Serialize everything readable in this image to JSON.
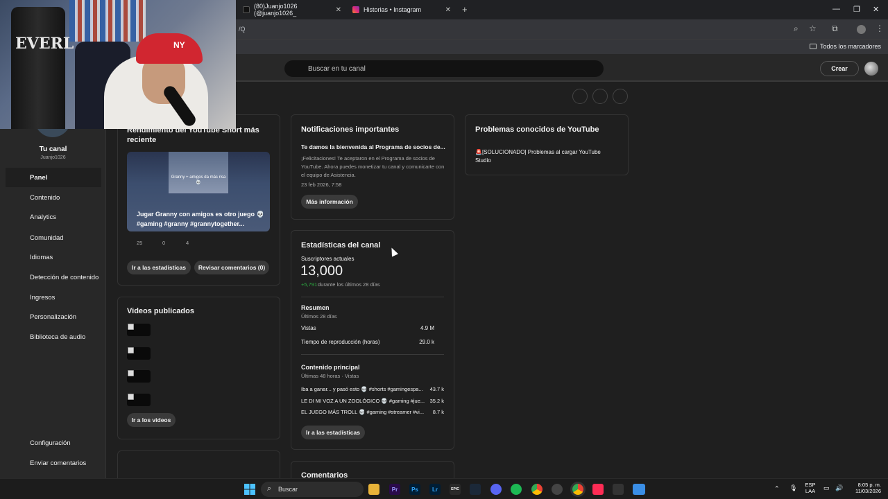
{
  "browser": {
    "tabs": [
      {
        "label": "(80)Juanjo1026 (@juanjo1026_"
      },
      {
        "label": "Historias • Instagram"
      }
    ],
    "address_fragment": "/Q",
    "bookmarks_label": "Todos los marcadores"
  },
  "header": {
    "search_placeholder": "Buscar en tu canal",
    "create_label": "Crear"
  },
  "sidebar": {
    "channel_name": "Tu canal",
    "channel_handle": "Juanjo1026",
    "items": [
      {
        "label": "Panel"
      },
      {
        "label": "Contenido"
      },
      {
        "label": "Analytics"
      },
      {
        "label": "Comunidad"
      },
      {
        "label": "Idiomas"
      },
      {
        "label": "Detección de contenido"
      },
      {
        "label": "Ingresos"
      },
      {
        "label": "Personalización"
      },
      {
        "label": "Biblioteca de audio"
      }
    ],
    "footer": [
      {
        "label": "Configuración"
      },
      {
        "label": "Enviar comentarios"
      }
    ]
  },
  "short_card": {
    "title": "Rendimiento del YouTube Short más reciente",
    "thumb_overlay": "Granny + amigos da más risa 💀",
    "video_title": "Jugar Granny con amigos es otro juego 💀 #gaming #granny #grannytogether...",
    "metrics": [
      "25",
      "0",
      "4"
    ],
    "stats_button": "Ir a las estadísticas",
    "comments_button": "Revisar comentarios (0)"
  },
  "videos_card": {
    "title": "Videos publicados",
    "button": "Ir a los videos"
  },
  "notifications": {
    "title": "Notificaciones importantes",
    "headline": "Te damos la bienvenida al Programa de socios de...",
    "body": "¡Felicitaciones! Te aceptaron en el Programa de socios de YouTube. Ahora puedes monetizar tu canal y comunicarte con el equipo de Asistencia.",
    "date": "23 feb 2026, 7:58",
    "button": "Más información"
  },
  "known_issues": {
    "title": "Problemas conocidos de YouTube",
    "item": "🚨[SOLUCIONADO] Problemas al cargar YouTube Studio"
  },
  "channel_stats": {
    "title": "Estadísticas del canal",
    "subs_label": "Suscriptores actuales",
    "subs_value": "13,000",
    "subs_delta": "+5,791",
    "subs_delta_text": "durante los últimos 28 días",
    "summary_title": "Resumen",
    "summary_period": "Últimos 28 días",
    "rows": [
      {
        "label": "Vistas",
        "value": "4.9 M"
      },
      {
        "label": "Tiempo de reproducción (horas)",
        "value": "29.0 k"
      }
    ],
    "top_title": "Contenido principal",
    "top_period": "Últimas 48 horas · Vistas",
    "top_items": [
      {
        "label": "Iba a ganar... y pasó esto 💀 #shorts #gamingespa...",
        "value": "43.7 k"
      },
      {
        "label": "LE DI MI VOZ A UN ZOOLÓGICO 💀 #gaming #jue...",
        "value": "35.2 k"
      },
      {
        "label": "EL JUEGO MÁS TROLL 💀 #gaming #streamer #vi...",
        "value": "8.7 k"
      }
    ],
    "button": "Ir a las estadísticas"
  },
  "comments_card": {
    "title": "Comentarios"
  },
  "webcam": {
    "bag_text": "EVERL",
    "cap_text": "NY"
  },
  "taskbar": {
    "search_label": "Buscar",
    "app_icons": [
      "Pr",
      "Ps",
      "Lr",
      "EPIC"
    ],
    "lang_top": "ESP",
    "lang_bottom": "LAA",
    "time": "8:05 p. m.",
    "date": "11/03/2026"
  },
  "colors": {
    "accent_green": "#2ba640",
    "brand_red": "#d12630"
  }
}
